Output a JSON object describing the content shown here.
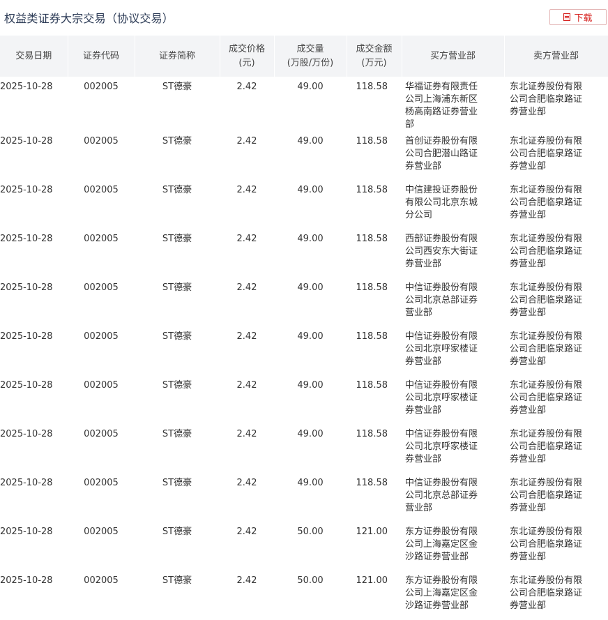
{
  "page": {
    "title": "权益类证券大宗交易（协议交易）",
    "download_label": "下载",
    "accent_color": "#d6201e"
  },
  "table": {
    "headers": {
      "date": "交易日期",
      "code": "证券代码",
      "name": "证券简称",
      "price_l1": "成交价格",
      "price_l2": "(元)",
      "volume_l1": "成交量",
      "volume_l2": "(万股/万份)",
      "amount_l1": "成交金额",
      "amount_l2": "(万元)",
      "buyer": "买方营业部",
      "seller": "卖方营业部"
    },
    "rows": [
      {
        "date": "2025-10-28",
        "code": "002005",
        "name": "ST德豪",
        "price": "2.42",
        "volume": "49.00",
        "amount": "118.58",
        "buyer": "华福证券有限责任公司上海浦东新区杨高南路证券营业部",
        "seller": "东北证券股份有限公司合肥临泉路证券营业部"
      },
      {
        "date": "2025-10-28",
        "code": "002005",
        "name": "ST德豪",
        "price": "2.42",
        "volume": "49.00",
        "amount": "118.58",
        "buyer": "首创证券股份有限公司合肥潜山路证券营业部",
        "seller": "东北证券股份有限公司合肥临泉路证券营业部"
      },
      {
        "date": "2025-10-28",
        "code": "002005",
        "name": "ST德豪",
        "price": "2.42",
        "volume": "49.00",
        "amount": "118.58",
        "buyer": "中信建投证券股份有限公司北京东城分公司",
        "seller": "东北证券股份有限公司合肥临泉路证券营业部"
      },
      {
        "date": "2025-10-28",
        "code": "002005",
        "name": "ST德豪",
        "price": "2.42",
        "volume": "49.00",
        "amount": "118.58",
        "buyer": "西部证券股份有限公司西安东大街证券营业部",
        "seller": "东北证券股份有限公司合肥临泉路证券营业部"
      },
      {
        "date": "2025-10-28",
        "code": "002005",
        "name": "ST德豪",
        "price": "2.42",
        "volume": "49.00",
        "amount": "118.58",
        "buyer": "中信证券股份有限公司北京总部证券营业部",
        "seller": "东北证券股份有限公司合肥临泉路证券营业部"
      },
      {
        "date": "2025-10-28",
        "code": "002005",
        "name": "ST德豪",
        "price": "2.42",
        "volume": "49.00",
        "amount": "118.58",
        "buyer": "中信证券股份有限公司北京呼家楼证券营业部",
        "seller": "东北证券股份有限公司合肥临泉路证券营业部"
      },
      {
        "date": "2025-10-28",
        "code": "002005",
        "name": "ST德豪",
        "price": "2.42",
        "volume": "49.00",
        "amount": "118.58",
        "buyer": "中信证券股份有限公司北京呼家楼证券营业部",
        "seller": "东北证券股份有限公司合肥临泉路证券营业部"
      },
      {
        "date": "2025-10-28",
        "code": "002005",
        "name": "ST德豪",
        "price": "2.42",
        "volume": "49.00",
        "amount": "118.58",
        "buyer": "中信证券股份有限公司北京呼家楼证券营业部",
        "seller": "东北证券股份有限公司合肥临泉路证券营业部"
      },
      {
        "date": "2025-10-28",
        "code": "002005",
        "name": "ST德豪",
        "price": "2.42",
        "volume": "49.00",
        "amount": "118.58",
        "buyer": "中信证券股份有限公司北京总部证券营业部",
        "seller": "东北证券股份有限公司合肥临泉路证券营业部"
      },
      {
        "date": "2025-10-28",
        "code": "002005",
        "name": "ST德豪",
        "price": "2.42",
        "volume": "50.00",
        "amount": "121.00",
        "buyer": "东方证券股份有限公司上海嘉定区金沙路证券营业部",
        "seller": "东北证券股份有限公司合肥临泉路证券营业部"
      },
      {
        "date": "2025-10-28",
        "code": "002005",
        "name": "ST德豪",
        "price": "2.42",
        "volume": "50.00",
        "amount": "121.00",
        "buyer": "东方证券股份有限公司上海嘉定区金沙路证券营业部",
        "seller": "东北证券股份有限公司合肥临泉路证券营业部"
      }
    ]
  }
}
